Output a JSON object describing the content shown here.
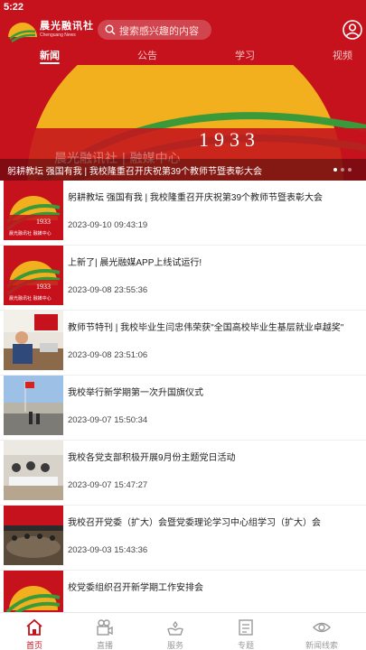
{
  "status_bar": {
    "time": "5:22"
  },
  "header": {
    "logo_name": "晨光融讯社",
    "logo_sub": "Chenguang News",
    "search_placeholder": "搜索感兴趣的内容"
  },
  "tabs": [
    {
      "label": "新闻",
      "active": true
    },
    {
      "label": "公告",
      "active": false
    },
    {
      "label": "学习",
      "active": false
    },
    {
      "label": "视频",
      "active": false
    }
  ],
  "banner": {
    "caption": "躬耕教坛 强国有我 | 我校隆重召开庆祝第39个教师节暨表彰大会",
    "year": "1933",
    "overlay_text": "晨光融讯社 | 融媒中心",
    "page_count": 3,
    "active_index": 0
  },
  "news": [
    {
      "title": "躬耕教坛 强国有我 | 我校隆重召开庆祝第39个教师节暨表彰大会",
      "date": "2023-09-10 09:43:19",
      "thumb": "logo"
    },
    {
      "title": "上新了| 晨光融媒APP上线试运行!",
      "date": "2023-09-08 23:55:36",
      "thumb": "logo"
    },
    {
      "title": "教师节特刊 | 我校毕业生闫忠伟荣获\"全国高校毕业生基层就业卓越奖\"",
      "date": "2023-09-08 23:51:06",
      "thumb": "office"
    },
    {
      "title": "我校举行新学期第一次升国旗仪式",
      "date": "2023-09-07 15:50:34",
      "thumb": "flag"
    },
    {
      "title": "我校各党支部积极开展9月份主题党日活动",
      "date": "2023-09-07 15:47:27",
      "thumb": "meeting"
    },
    {
      "title": "我校召开党委（扩大）会暨党委理论学习中心组学习（扩大）会",
      "date": "2023-09-03 15:43:36",
      "thumb": "hall"
    },
    {
      "title": "校党委组织召开新学期工作安排会",
      "date": "",
      "thumb": "logo"
    }
  ],
  "thumb_logo": {
    "year": "1933",
    "sub": "晨光融讯社 融媒中心"
  },
  "bottom_nav": [
    {
      "label": "首页",
      "icon": "home-icon",
      "active": true
    },
    {
      "label": "直播",
      "icon": "live-camera-icon",
      "active": false
    },
    {
      "label": "服务",
      "icon": "service-hand-icon",
      "active": false
    },
    {
      "label": "专题",
      "icon": "topic-document-icon",
      "active": false
    },
    {
      "label": "新闻线索",
      "icon": "news-clue-eye-icon",
      "active": false
    }
  ],
  "colors": {
    "brand_red": "#c5121d",
    "gold": "#f2b01e",
    "green": "#3a9a3a"
  }
}
